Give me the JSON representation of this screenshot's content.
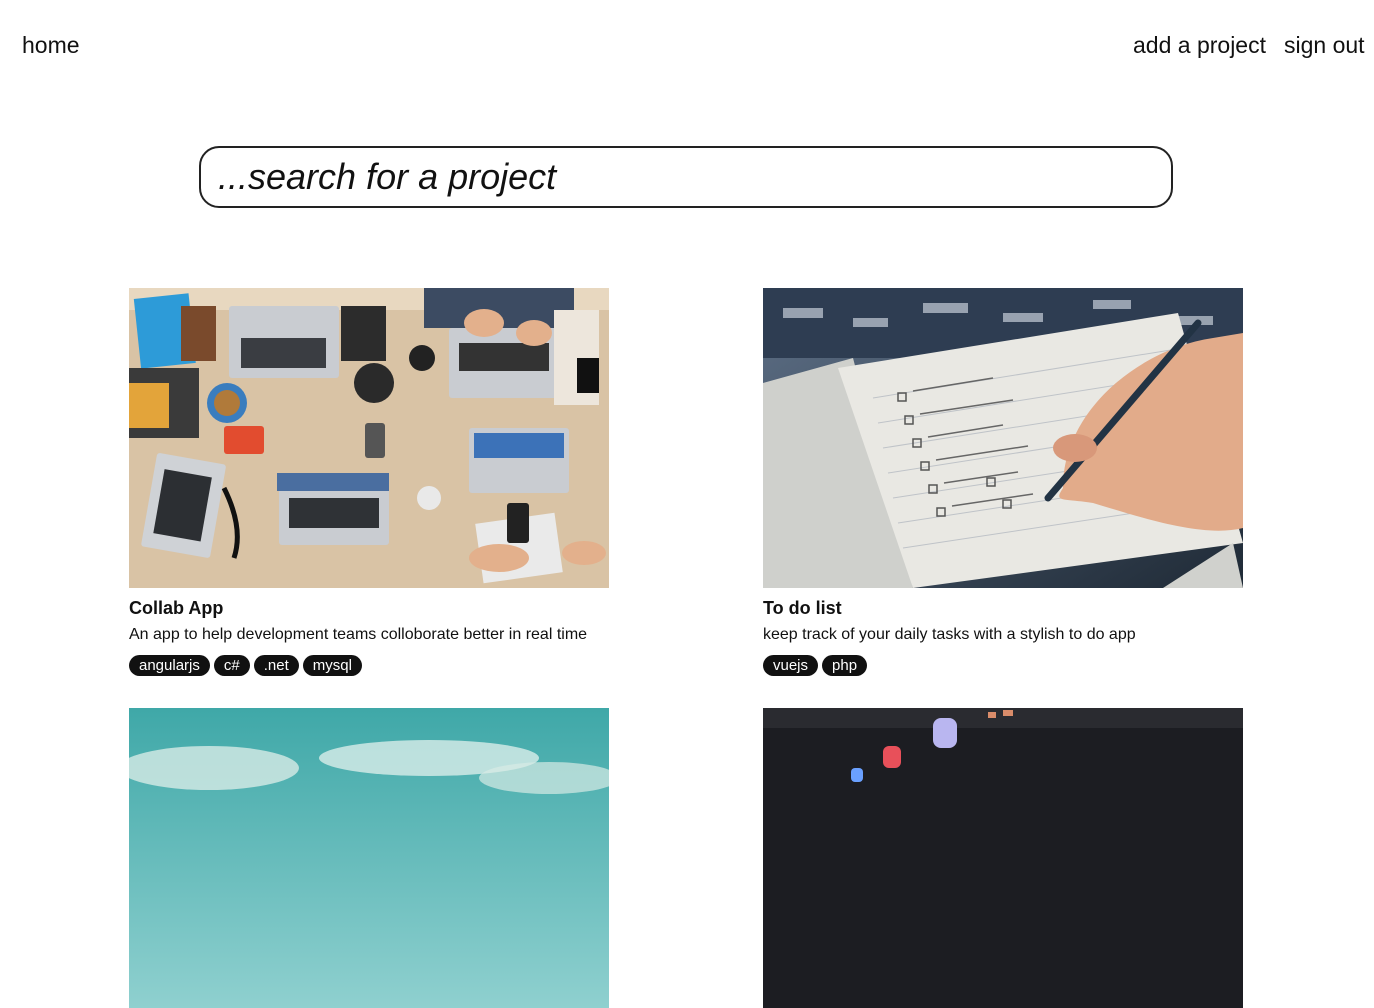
{
  "nav": {
    "home": "home",
    "add_project": "add a project",
    "sign_out": "sign out"
  },
  "search": {
    "placeholder": "...search for a project",
    "value": ""
  },
  "projects": [
    {
      "title": "Collab App",
      "description": "An app to help development teams colloborate better in real time",
      "tags": [
        "angularjs",
        "c#",
        ".net",
        "mysql"
      ],
      "image": "laptops-on-desk-photo"
    },
    {
      "title": "To do list",
      "description": "keep track of your daily tasks with a stylish to do app",
      "tags": [
        "vuejs",
        "php"
      ],
      "image": "notebook-checklist-photo"
    },
    {
      "image": "sky-clouds-photo"
    },
    {
      "image": "arcade-screen-photo"
    }
  ]
}
